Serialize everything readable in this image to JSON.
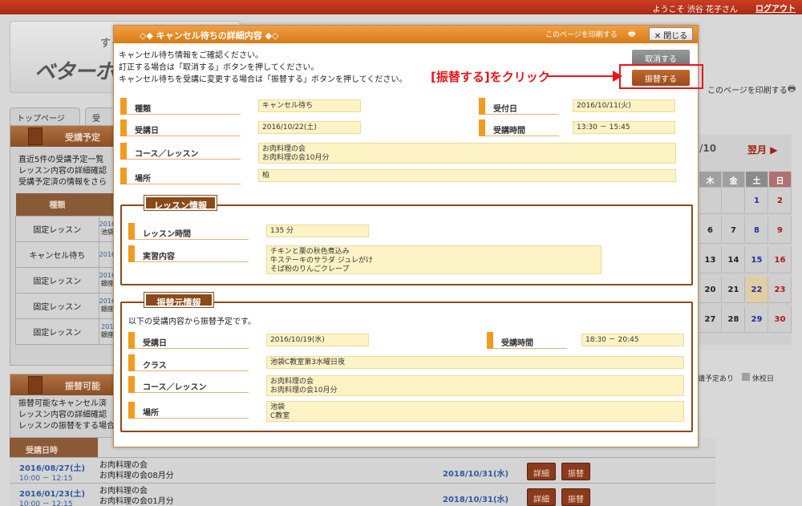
{
  "header": {
    "welcome": "ようこそ 渋谷 花子さん",
    "logout": "ログアウト"
  },
  "background": {
    "logo_sub": "すぐに役立",
    "logo_main": "ベターホーム",
    "print_label": "このページを印刷する",
    "tabs": [
      "トップページ",
      "受"
    ],
    "panel1_title": "受講予定",
    "panel1_lines": [
      "直近5件の受講予定一覧",
      "レッスン内容の詳細確認",
      "受講予定済の情報をさら"
    ],
    "table_header": "種類",
    "table_rows": [
      {
        "type": "固定レッスン",
        "date": "2016",
        "place": "池袋"
      },
      {
        "type": "キャンセル待ち",
        "date": "2016",
        "place": ""
      },
      {
        "type": "固定レッスン",
        "date": "2016",
        "place": "銀座"
      },
      {
        "type": "固定レッスン",
        "date": "2016",
        "place": "銀座"
      },
      {
        "type": "固定レッスン",
        "date": "201",
        "place": "銀座"
      }
    ],
    "panel2_title": "振替可能",
    "panel2_lines": [
      "振替可能なキャンセル済",
      "レッスン内容の詳細確認",
      "レッスンの振替をする場合"
    ],
    "list_header": "受講日時",
    "list_rows": [
      {
        "date": "2016/08/27(土)",
        "time": "10:00 － 12:15",
        "line1": "お肉料理の会",
        "line2": "お肉料理の会08月分",
        "deadline": "2018/10/31(水)",
        "detail": "詳細",
        "transfer": "振替"
      },
      {
        "date": "2016/01/23(土)",
        "time": "10:00 － 12:15",
        "line1": "お肉料理の会",
        "line2": "お肉料理の会01月分",
        "deadline": "2018/10/31(水)",
        "detail": "詳細",
        "transfer": "振替"
      }
    ],
    "calendar": {
      "month_fragment": "/10",
      "next_month": "翌月",
      "weekday_headers": [
        "木",
        "金",
        "土",
        "日"
      ],
      "rows": [
        [
          "",
          "",
          "1",
          "2"
        ],
        [
          "6",
          "7",
          "8",
          "9"
        ],
        [
          "13",
          "14",
          "15",
          "16"
        ],
        [
          "20",
          "21",
          "22",
          "23"
        ],
        [
          "27",
          "28",
          "29",
          "30"
        ]
      ],
      "legend_left": "講予定あり",
      "legend_right": "休校日"
    }
  },
  "modal": {
    "title": "◇◆ キャンセル待ちの詳細内容 ◆◇",
    "print_label": "このページを印刷する",
    "close_label": "閉じる",
    "intro_lines": [
      "キャンセル待ち情報をご確認ください。",
      "訂正する場合は「取消する」ボタンを押してください。",
      "キャンセル待ちを受講に変更する場合は「振替する」ボタンを押してください。"
    ],
    "cancel_button": "取消する",
    "transfer_button": "振替する",
    "fields": {
      "type_label": "種類",
      "type_value": "キャンセル待ち",
      "received_label": "受付日",
      "received_value": "2016/10/11(火)",
      "lesson_date_label": "受講日",
      "lesson_date_value": "2016/10/22(土)",
      "lesson_time_label": "受講時間",
      "lesson_time_value": "13:30 － 15:45",
      "course_label": "コース／レッスン",
      "course_value1": "お肉料理の会",
      "course_value2": "お肉料理の会10月分",
      "place_label": "場所",
      "place_value": "柏"
    },
    "lesson_info": {
      "title": "レッスン情報",
      "duration_label": "レッスン時間",
      "duration_value": "135 分",
      "content_label": "実習内容",
      "content_lines": [
        "チキンと栗の秋色煮込み",
        "牛ステーキのサラダ ジュレがけ",
        "そば粉のりんごクレープ"
      ]
    },
    "origin_info": {
      "title": "振替元情報",
      "note": "以下の受講内容から振替予定です。",
      "date_label": "受講日",
      "date_value": "2016/10/19(水)",
      "time_label": "受講時間",
      "time_value": "18:30 － 20:45",
      "class_label": "クラス",
      "class_value": "池袋C教室第3水曜日夜",
      "course_label": "コース／レッスン",
      "course_value1": "お肉料理の会",
      "course_value2": "お肉料理の会10月分",
      "place_label": "場所",
      "place_value1": "池袋",
      "place_value2": "C教室"
    }
  },
  "annotation": {
    "text": "[振替する]をクリック",
    "color": "#e8151a"
  }
}
